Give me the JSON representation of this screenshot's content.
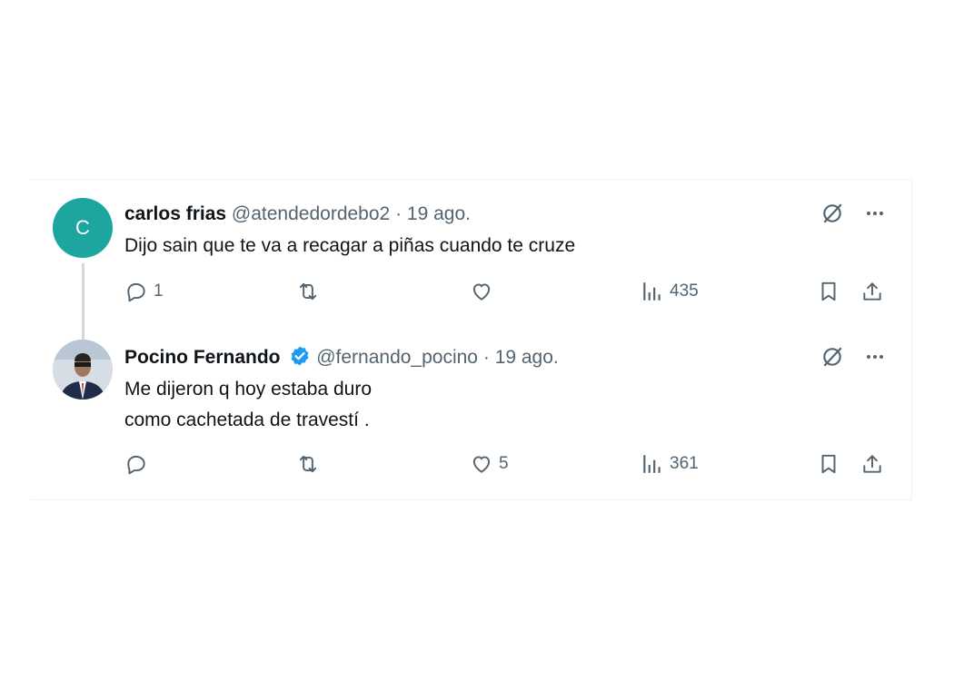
{
  "thread": [
    {
      "avatar_letter": "C",
      "avatar_color": "#1da5a0",
      "name": "carlos frias",
      "handle": "@atendedordebo2",
      "separator": "·",
      "date": "19 ago.",
      "text_lines": [
        "Dijo sain que te va a recagar a piñas cuando te cruze"
      ],
      "reply_count": "1",
      "retweet_count": "",
      "like_count": "",
      "view_count": "435"
    },
    {
      "name": "Pocino Fernando",
      "verified": true,
      "verified_color": "#1d9bf0",
      "handle": "@fernando_pocino",
      "separator": "·",
      "date": "19 ago.",
      "text_lines": [
        "Me dijeron q hoy estaba duro",
        "como cachetada de travestí ."
      ],
      "reply_count": "",
      "retweet_count": "",
      "like_count": "5",
      "view_count": "361"
    }
  ],
  "icons": {
    "grok": "grok-icon",
    "more": "more-icon",
    "reply": "reply-icon",
    "retweet": "retweet-icon",
    "like": "like-icon",
    "views": "views-icon",
    "bookmark": "bookmark-icon",
    "share": "share-icon"
  }
}
